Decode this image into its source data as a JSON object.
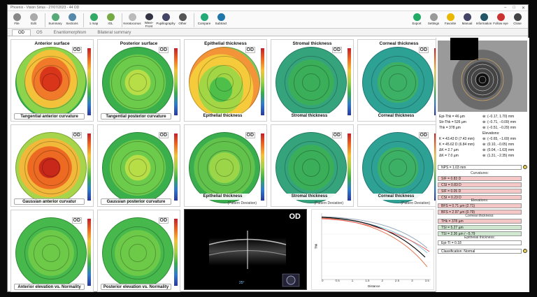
{
  "window": {
    "title": "Phoenix - Vision Sirius - 27/07/2023 - 44 OD",
    "controls": [
      "–",
      "□",
      "✕"
    ]
  },
  "toolbar": {
    "left": [
      {
        "label": "File",
        "icon": "file-icon",
        "color": "#888"
      },
      {
        "label": "Edit",
        "icon": "edit-icon",
        "color": "#aaa"
      },
      {
        "label": "Summary",
        "icon": "summary-icon",
        "color": "#5a7"
      },
      {
        "label": "Sections",
        "icon": "sections-icon",
        "color": "#58a"
      },
      {
        "label": "1 map",
        "icon": "map-icon",
        "color": "#3a6"
      },
      {
        "label": "IOL",
        "icon": "iol-icon",
        "color": "#7a4"
      },
      {
        "label": "Keratoconus",
        "icon": "keratoconus-icon",
        "color": "#bbb"
      },
      {
        "label": "Wave-Front",
        "icon": "wavefront-icon",
        "color": "#334"
      },
      {
        "label": "Pupillography",
        "icon": "pupil-icon",
        "color": "#446"
      },
      {
        "label": "Other",
        "icon": "more-icon",
        "color": "#555"
      },
      {
        "label": "Compare",
        "icon": "compare-icon",
        "color": "#2a7"
      },
      {
        "label": "Subtract",
        "icon": "subtract-icon",
        "color": "#27a"
      }
    ],
    "right": [
      {
        "label": "Export",
        "icon": "export-icon",
        "color": "#2a6"
      },
      {
        "label": "Settings",
        "icon": "settings-icon",
        "color": "#999"
      },
      {
        "label": "Favorite",
        "icon": "star-icon",
        "color": "#e9b800"
      },
      {
        "label": "Manual",
        "icon": "manual-icon",
        "color": "#446"
      },
      {
        "label": "Information",
        "icon": "info-icon",
        "color": "#256"
      },
      {
        "label": "Follow eye",
        "icon": "follow-eye-icon",
        "color": "#c33"
      },
      {
        "label": "Close",
        "icon": "close-icon",
        "color": "#444"
      }
    ]
  },
  "tabs": [
    "OD",
    "OS",
    "Enantiomorphism",
    "Bilateral summary"
  ],
  "eye_label": "OD",
  "maps": [
    {
      "title": "Anterior surface",
      "caption": "Tangential anterior curvature",
      "sub": "",
      "dropdown": true,
      "scheme": "warm"
    },
    {
      "title": "Posterior surface",
      "caption": "Tangential posterior curvature",
      "sub": "",
      "dropdown": true,
      "scheme": "green"
    },
    {
      "title": "Epithelial thickness",
      "caption": "Epithelial thickness",
      "sub": "",
      "dropdown": false,
      "scheme": "epi"
    },
    {
      "title": "Stromal thickness",
      "caption": "Stromal thickness",
      "sub": "",
      "dropdown": false,
      "scheme": "teal"
    },
    {
      "title": "Corneal thickness",
      "caption": "Corneal thickness",
      "sub": "",
      "dropdown": false,
      "scheme": "teal2"
    },
    {
      "title": "",
      "caption": "Gaussian anterior curvatur",
      "sub": "",
      "dropdown": true,
      "scheme": "warm2"
    },
    {
      "title": "",
      "caption": "Gaussian posterior curvature",
      "sub": "",
      "dropdown": true,
      "scheme": "green"
    },
    {
      "title": "",
      "caption": "Epithelial thickness",
      "sub": "(Pattern Deviation)",
      "dropdown": false,
      "scheme": "green2"
    },
    {
      "title": "",
      "caption": "Stromal thickness",
      "sub": "(Pattern Deviation)",
      "dropdown": false,
      "scheme": "teal"
    },
    {
      "title": "",
      "caption": "Corneal thickness",
      "sub": "(Pattern Deviation)",
      "dropdown": false,
      "scheme": "teal2"
    },
    {
      "title": "",
      "caption": "Anterior elevation vs. Normality",
      "sub": "",
      "dropdown": true,
      "scheme": "flat"
    },
    {
      "title": "",
      "caption": "Posterior elevation vs. Normality",
      "sub": "",
      "dropdown": true,
      "scheme": "flat"
    }
  ],
  "oct": {
    "label": "OD",
    "scale": "25°"
  },
  "graph": {
    "xlabel": "Distance",
    "ylabel": "Thk",
    "xticks": [
      "0",
      "0.5",
      "1",
      "1.5",
      "2",
      "2.5",
      "3",
      "3.5"
    ]
  },
  "right": {
    "params": [
      {
        "l": "Epi-Thk = 46 µm",
        "r": "⊕: (−0.17, 1.70) mm"
      },
      {
        "l": "Str-Thk = 526 µm",
        "r": "⊕: (−0.71, −0.09) mm"
      },
      {
        "l": "Thk = 378 µm",
        "r": "⊕: (−0.51, −0.29) mm"
      },
      {
        "l": "",
        "r": "Elevations:"
      },
      {
        "l": "K = 43.43 D (7.43 mm)",
        "r": "⊕: (−0.65, −1.69) mm"
      },
      {
        "l": "K = 45.62 D (6.84 mm)",
        "r": "⊕: (0.10, −0.05) mm"
      },
      {
        "l": "ΔK = 2.7 µm",
        "r": "⊕: (0.04, −1.63) mm"
      },
      {
        "l": "ΔK = 7.0 µm",
        "r": "⊕: (1.31, −2.35) mm"
      }
    ],
    "nps": "NPS = 1.03 mm",
    "s_curv": "Curvatures:",
    "curv": [
      {
        "t": "SIF = 0.83 D",
        "c": "r"
      },
      {
        "t": "CSI = 0.83 D",
        "c": "r"
      },
      {
        "t": "SIF = 0.05 D",
        "c": "r"
      },
      {
        "t": "CSI = 0.23 D",
        "c": "r"
      }
    ],
    "s_elev": "Elevations:",
    "elev": [
      {
        "t": "BFS = 0.71 µm (2.71)",
        "c": "r"
      },
      {
        "t": "BFS = 2.97 µm (0.79)",
        "c": "r"
      }
    ],
    "s_thk": "Corneal thickness:",
    "thk": [
      {
        "t": "THk = 378 µm",
        "c": "r"
      },
      {
        "t": "TSI = 5.27 µm",
        "c": "g"
      },
      {
        "t": "TSI = 2.36 µm / −5.79",
        "c": "g"
      }
    ],
    "s_epi": "Epithelial thickness:",
    "epi": [
      {
        "t": "Epi-TI = 0.18",
        "c": "w"
      }
    ],
    "classification": "Classification: Normal"
  }
}
